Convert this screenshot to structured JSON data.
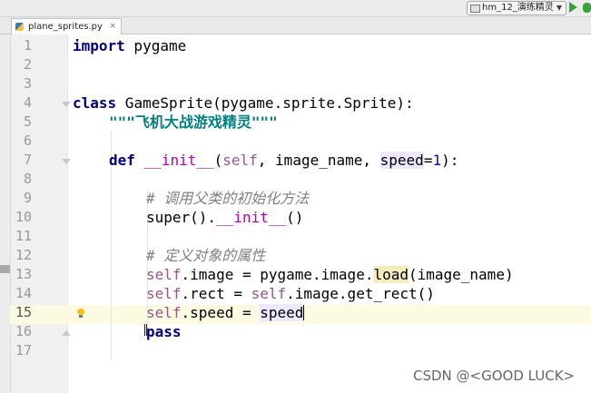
{
  "toolbar": {
    "run_config": "hm_12_演练精灵",
    "run_icon": "run-triangle-icon",
    "debug_icon": "debug-bug-icon"
  },
  "tab": {
    "filename": "plane_sprites.py",
    "close": "×"
  },
  "editor": {
    "current_line": 15,
    "line_numbers": [
      "1",
      "2",
      "3",
      "4",
      "5",
      "6",
      "7",
      "8",
      "9",
      "10",
      "11",
      "12",
      "13",
      "14",
      "15",
      "16",
      "17"
    ],
    "lines": {
      "l1_kw": "import",
      "l1_rest": " pygame",
      "l4_kw": "class",
      "l4_rest": " GameSprite(pygame.sprite.Sprite):",
      "l5_doc": "\"\"\"飞机大战游戏精灵\"\"\"",
      "l7_kw": "def",
      "l7_init": "__init__",
      "l7_open": "(",
      "l7_self": "self",
      "l7_mid": ", image_name, ",
      "l7_speed": "speed",
      "l7_eq": "=",
      "l7_num": "1",
      "l7_close": "):",
      "l9_comment": "# 调用父类的初始化方法",
      "l10_super": "super().",
      "l10_init": "__init__",
      "l10_close": "()",
      "l12_comment": "# 定义对象的属性",
      "l13_self": "self",
      "l13_a": ".image = pygame.image.",
      "l13_load": "load",
      "l13_b": "(image_name)",
      "l14_self1": "self",
      "l14_a": ".rect = ",
      "l14_self2": "self",
      "l14_b": ".image.get_rect()",
      "l15_self": "self",
      "l15_a": ".speed = ",
      "l15_speed": "speed",
      "l16_kw": "pass"
    }
  },
  "watermark": "CSDN @<GOOD LUCK>"
}
